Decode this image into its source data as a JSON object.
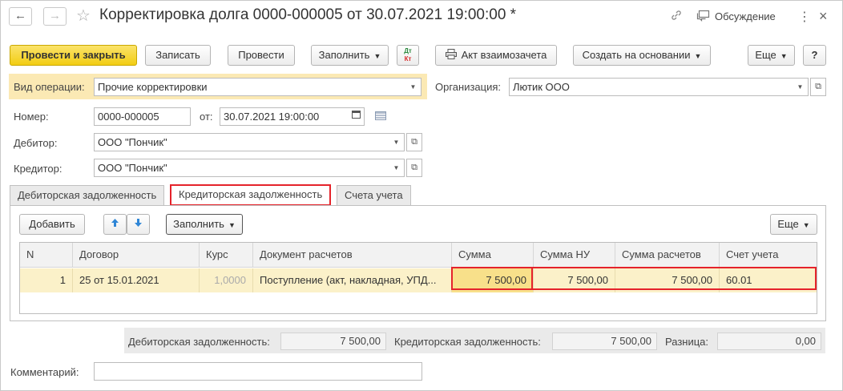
{
  "window": {
    "title": "Корректировка долга 0000-000005 от 30.07.2021 19:00:00 *",
    "discussion_label": "Обсуждение",
    "nav_back_icon": "arrow-left-icon",
    "nav_forward_icon": "arrow-right-icon",
    "favorite_icon": "star-icon",
    "link_icon": "link-icon",
    "discussion_icon": "chat-icon",
    "more_icon": "vertical-dots-icon",
    "close_icon": "close-icon"
  },
  "toolbar": {
    "post_close": "Провести и закрыть",
    "write": "Записать",
    "post": "Провести",
    "fill": "Заполнить",
    "dtkt_top": "Дт",
    "dtkt_bottom": "Кт",
    "act_label": "Акт взаимозачета",
    "create_based": "Создать на основании",
    "more": "Еще",
    "help": "?"
  },
  "form": {
    "operation_label": "Вид операции:",
    "operation_value": "Прочие корректировки",
    "org_label": "Организация:",
    "org_value": "Лютик ООО",
    "number_label": "Номер:",
    "number_value": "0000-000005",
    "date_label": "от:",
    "date_value": "30.07.2021 19:00:00",
    "debtor_label": "Дебитор:",
    "debtor_value": "ООО \"Пончик\"",
    "creditor_label": "Кредитор:",
    "creditor_value": "ООО \"Пончик\""
  },
  "tabs": [
    {
      "label": "Дебиторская задолженность",
      "active": false
    },
    {
      "label": "Кредиторская задолженность",
      "active": true
    },
    {
      "label": "Счета учета",
      "active": false
    }
  ],
  "panel_toolbar": {
    "add": "Добавить",
    "fill": "Заполнить",
    "more": "Еще"
  },
  "table": {
    "columns": [
      "N",
      "Договор",
      "Курс",
      "Документ расчетов",
      "Сумма",
      "Сумма НУ",
      "Сумма расчетов",
      "Счет учета"
    ],
    "rows": [
      {
        "n": "1",
        "contract": "25 от 15.01.2021",
        "rate": "1,0000",
        "document": "Поступление (акт, накладная, УПД...",
        "sum": "7 500,00",
        "sum_nu": "7 500,00",
        "sum_settl": "7 500,00",
        "account": "60.01"
      }
    ]
  },
  "totals": {
    "debt_label": "Дебиторская задолженность:",
    "debt_value": "7 500,00",
    "credit_label": "Кредиторская задолженность:",
    "credit_value": "7 500,00",
    "diff_label": "Разница:",
    "diff_value": "0,00"
  },
  "comment_label": "Комментарий:",
  "comment_value": "",
  "colors": {
    "primary_button": "#f2cd13",
    "highlight_border": "#e5232b",
    "row_selected": "#fbf1c9",
    "operation_bg": "#fbe9b4"
  }
}
